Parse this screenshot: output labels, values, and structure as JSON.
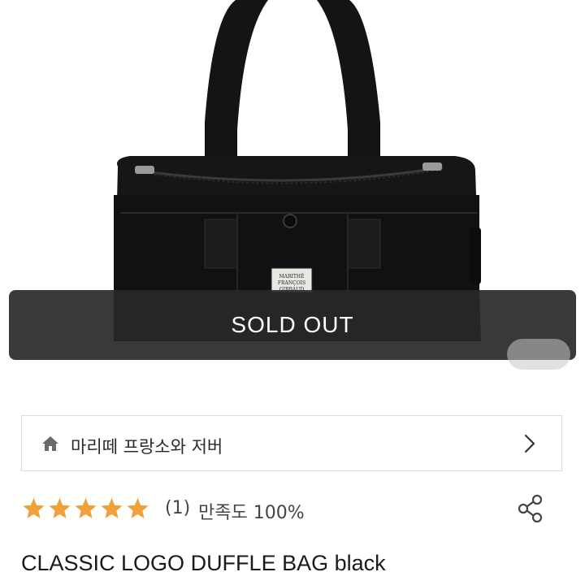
{
  "product_image": {
    "icon": "duffle-bag-image",
    "label_patch_text": "MARITHÉ FRANÇOIS GIRBAUD",
    "overlay_text": "SOLD OUT"
  },
  "brand": {
    "icon": "home-icon",
    "name": "마리떼 프랑소와 저버",
    "chevron_icon": "chevron-right-icon"
  },
  "rating": {
    "stars": 5,
    "max_stars": 5,
    "star_color": "#F0A23A",
    "count_text": "(1)",
    "satisfaction_text": "만족도 100%",
    "share_icon": "share-icon"
  },
  "product": {
    "title": "CLASSIC LOGO DUFFLE BAG black"
  }
}
